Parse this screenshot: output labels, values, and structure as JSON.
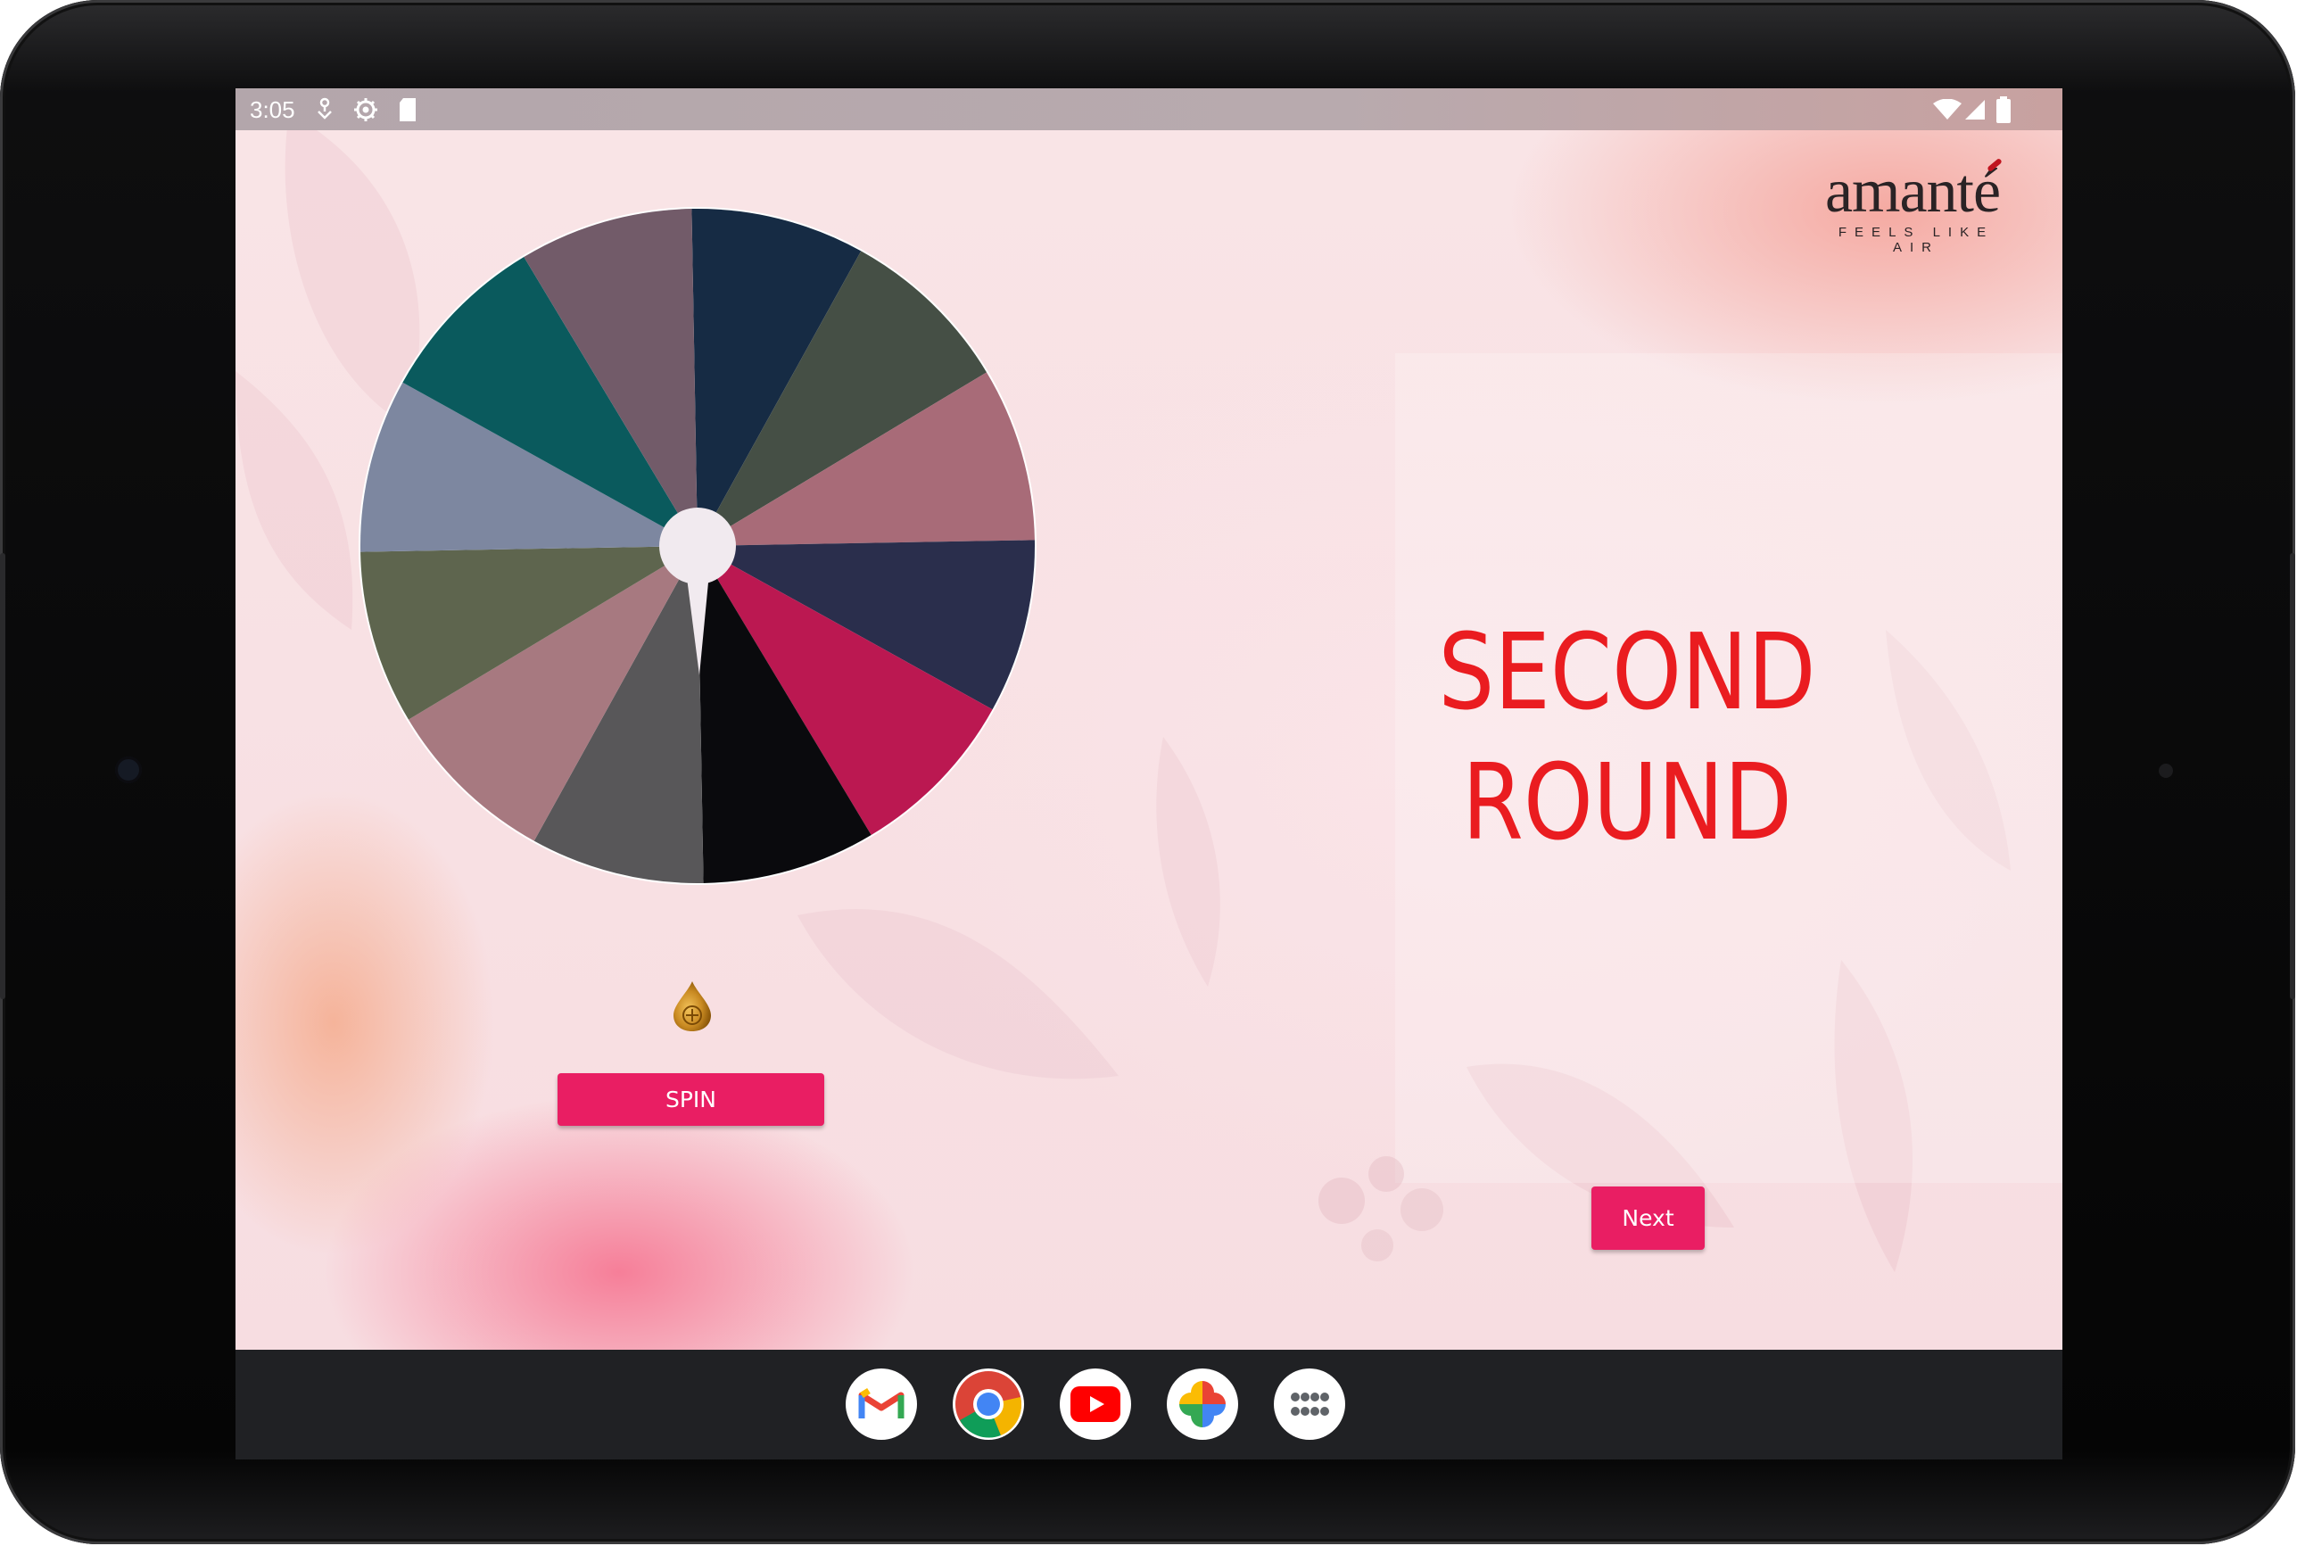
{
  "status_bar": {
    "time": "3:05",
    "left_icons": [
      "location-icon",
      "settings-gear-icon",
      "sd-card-icon"
    ],
    "right_icons": [
      "wifi-icon",
      "cellular-signal-icon",
      "battery-icon"
    ]
  },
  "brand": {
    "name": "amanté",
    "tagline": "FEELS LIKE AIR",
    "accent_color": "#c0141e"
  },
  "wheel": {
    "segment_count": 12,
    "segment_colors": [
      "#162b44",
      "#454f45",
      "#a86b78",
      "#2a2e4c",
      "#bb1851",
      "#0a0a0d",
      "#585759",
      "#a77980",
      "#5e654e",
      "#7d87a0",
      "#0a5a5d",
      "#725b69"
    ],
    "hub_color": "#f1eaef",
    "pointer_icon": "gold-drop-pointer-icon"
  },
  "spin_button": {
    "label": "SPIN"
  },
  "round_title": {
    "line1": "SECOND",
    "line2": "ROUND"
  },
  "next_button": {
    "label": "Next"
  },
  "dock": {
    "apps": [
      "gmail-icon",
      "chrome-icon",
      "youtube-icon",
      "google-photos-icon",
      "app-drawer-icon"
    ]
  },
  "colors": {
    "button": "#e91e63",
    "title": "#ea1c20",
    "background": "#f9e2e5"
  }
}
